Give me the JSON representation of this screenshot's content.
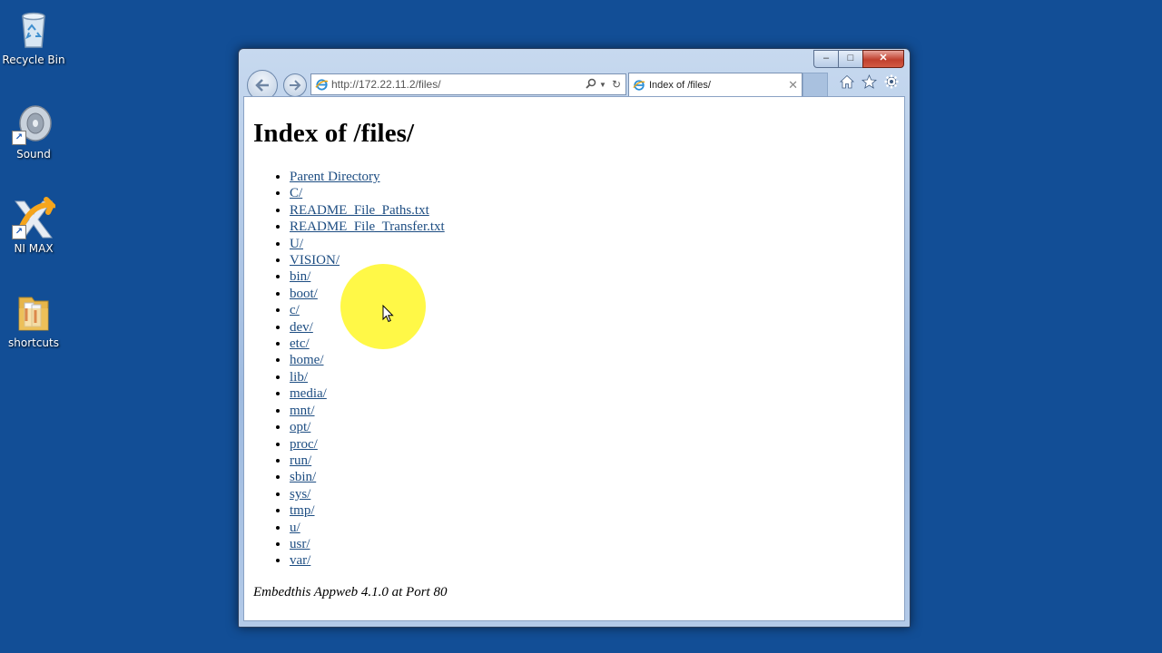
{
  "desktop": {
    "icons": [
      {
        "label": "Recycle Bin",
        "icon": "recycle-bin-icon"
      },
      {
        "label": "Sound",
        "icon": "speaker-icon"
      },
      {
        "label": "NI MAX",
        "icon": "ni-max-icon"
      },
      {
        "label": "shortcuts",
        "icon": "folder-icon"
      }
    ]
  },
  "browser": {
    "address": "http://172.22.11.2/files/",
    "tab_title": "Index of /files/",
    "caption": {
      "minimize": "–",
      "maximize": "□",
      "close": "✕"
    }
  },
  "page": {
    "heading": "Index of /files/",
    "links": [
      "Parent Directory",
      "C/",
      "README_File_Paths.txt",
      "README_File_Transfer.txt",
      "U/",
      "VISION/",
      "bin/",
      "boot/",
      "c/",
      "dev/",
      "etc/",
      "home/",
      "lib/",
      "media/",
      "mnt/",
      "opt/",
      "proc/",
      "run/",
      "sbin/",
      "sys/",
      "tmp/",
      "u/",
      "usr/",
      "var/"
    ],
    "footer": "Embedthis Appweb 4.1.0 at Port 80"
  }
}
